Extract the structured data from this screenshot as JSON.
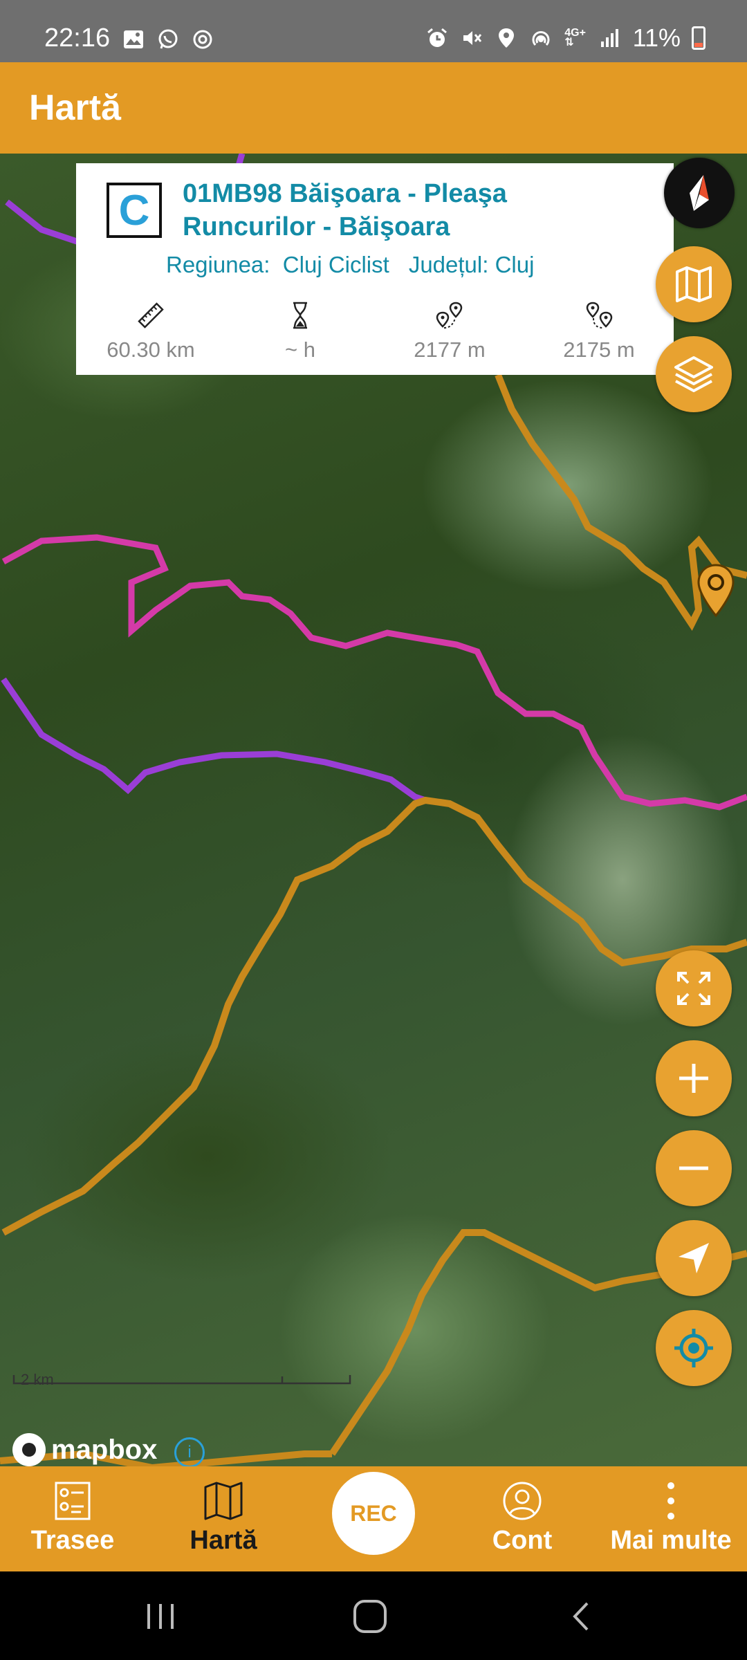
{
  "status_bar": {
    "time": "22:16",
    "battery": "11%",
    "left_icons": [
      "image-icon",
      "whatsapp-icon",
      "sync-icon"
    ],
    "right_icons": [
      "alarm-icon",
      "mute-icon",
      "location-icon",
      "hotspot-icon",
      "network-4g-icon",
      "signal-icon"
    ]
  },
  "header": {
    "title": "Hartă"
  },
  "route_card": {
    "badge": "C",
    "title_line1": "01MB98 Băişoara - Pleaşa",
    "title_line2": "Runcurilor -  Băişoara",
    "region_label": "Regiunea:",
    "region_value": "Cluj Ciclist",
    "county_label": "Județul:",
    "county_value": "Cluj",
    "stats": [
      {
        "icon": "ruler-icon",
        "value": "60.30 km"
      },
      {
        "icon": "hourglass-icon",
        "value": "~ h"
      },
      {
        "icon": "elevation-up-icon",
        "value": "2177 m"
      },
      {
        "icon": "elevation-down-icon",
        "value": "2175 m"
      }
    ]
  },
  "map": {
    "scale_label": "2 km",
    "attribution": "mapbox",
    "info_symbol": "i"
  },
  "map_controls": [
    "compass-icon",
    "map-icon",
    "layers-icon",
    "fullscreen-icon",
    "zoom-in-icon",
    "zoom-out-icon",
    "navigate-icon",
    "my-location-icon"
  ],
  "bottom_nav": {
    "trasee": "Trasee",
    "harta": "Hartă",
    "rec": "REC",
    "cont": "Cont",
    "mai_multe": "Mai multe"
  },
  "colors": {
    "accent": "#e39a24",
    "route_title": "#138ba6",
    "route_orange": "#c9891c",
    "route_magenta": "#d43aa8",
    "route_purple": "#9a3ed6"
  }
}
